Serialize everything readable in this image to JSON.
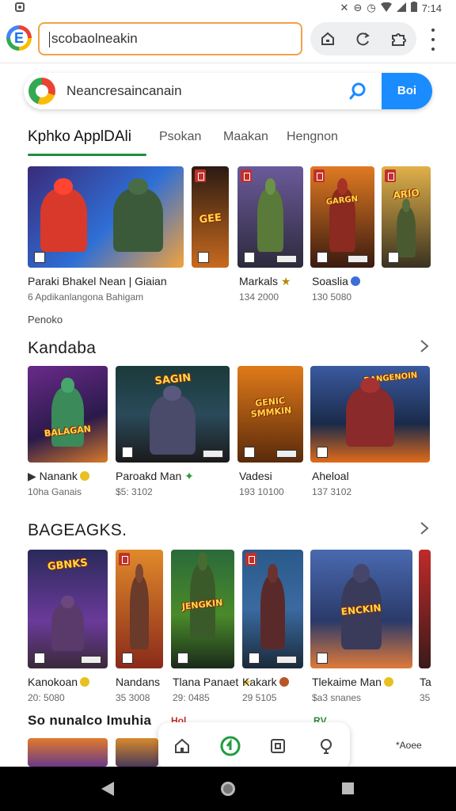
{
  "status_bar": {
    "time": "7:14",
    "left_icon": "notification-icon",
    "right_icons": [
      "mute-icon",
      "dnd-icon",
      "clock-icon",
      "wifi-icon",
      "signal-icon",
      "battery-icon"
    ]
  },
  "browser": {
    "logo_letter": "E",
    "url": "scobaolneakin",
    "actions": [
      "home-icon",
      "refresh-icon",
      "extensions-icon"
    ]
  },
  "store_search": {
    "text": "Neancresaincanain",
    "button_label": "Boi",
    "accent": "#1a8cff"
  },
  "tabs": [
    {
      "label": "Kphko ApplDAli",
      "active": true
    },
    {
      "label": "Psokan",
      "active": false
    },
    {
      "label": "Maakan",
      "active": false
    },
    {
      "label": "Hengnon",
      "active": false
    }
  ],
  "featured": {
    "items": [
      {
        "title": "Paraki Bhakel   Nean | Giaian",
        "sub": "6 Apdikanlangona  Bahigam",
        "logo": ""
      },
      {
        "title": "",
        "sub": "",
        "logo": "GEE"
      },
      {
        "title": "Markals",
        "sub": "134 2000",
        "logo": ""
      },
      {
        "title": "Soaslia",
        "sub": "130 5080",
        "logo": "GARGN"
      },
      {
        "title": "",
        "sub": "",
        "logo": "ARIO"
      }
    ],
    "caption": "Penoko"
  },
  "section2": {
    "title": "Kandaba",
    "items": [
      {
        "title": "Nanank",
        "sub": "10ha Ganais",
        "logo": "BALAGAN"
      },
      {
        "title": "Paroakd     Man",
        "sub": "$5: 3102",
        "logo": "SAGIN"
      },
      {
        "title": "Vadesi",
        "sub": "193 10100",
        "logo": "GENIC SMMKIN"
      },
      {
        "title": "Aheloal",
        "sub": "137 3102",
        "logo": "RANGENOIN"
      }
    ]
  },
  "section3": {
    "title": "BAGEAGKS.",
    "items": [
      {
        "title": "Kanokoan",
        "sub": "20: 5080",
        "logo": "GBNKS"
      },
      {
        "title": "Nandans",
        "sub": "35 3008",
        "logo": ""
      },
      {
        "title": "Tlana Panaet",
        "sub": "29: 0485",
        "logo": "JENGKIN"
      },
      {
        "title": "Kakark",
        "sub": "29 5105",
        "logo": ""
      },
      {
        "title": "Tlekaime Man",
        "sub": "$a3 snanes",
        "logo": "ENCKIN"
      },
      {
        "title": "Ta",
        "sub": "35",
        "logo": ""
      }
    ]
  },
  "section4": {
    "title": "So nunalco Imuhia",
    "tag_left": "Hol",
    "tag_right": "ŖV",
    "small_right": "*Aoee"
  },
  "bottom_nav": [
    "home-icon",
    "apps-icon",
    "library-icon",
    "profile-icon"
  ],
  "colors": {
    "tab_underline": "#1e8e3e",
    "url_border": "#f0a24a",
    "badge_red": "#c0302a"
  }
}
